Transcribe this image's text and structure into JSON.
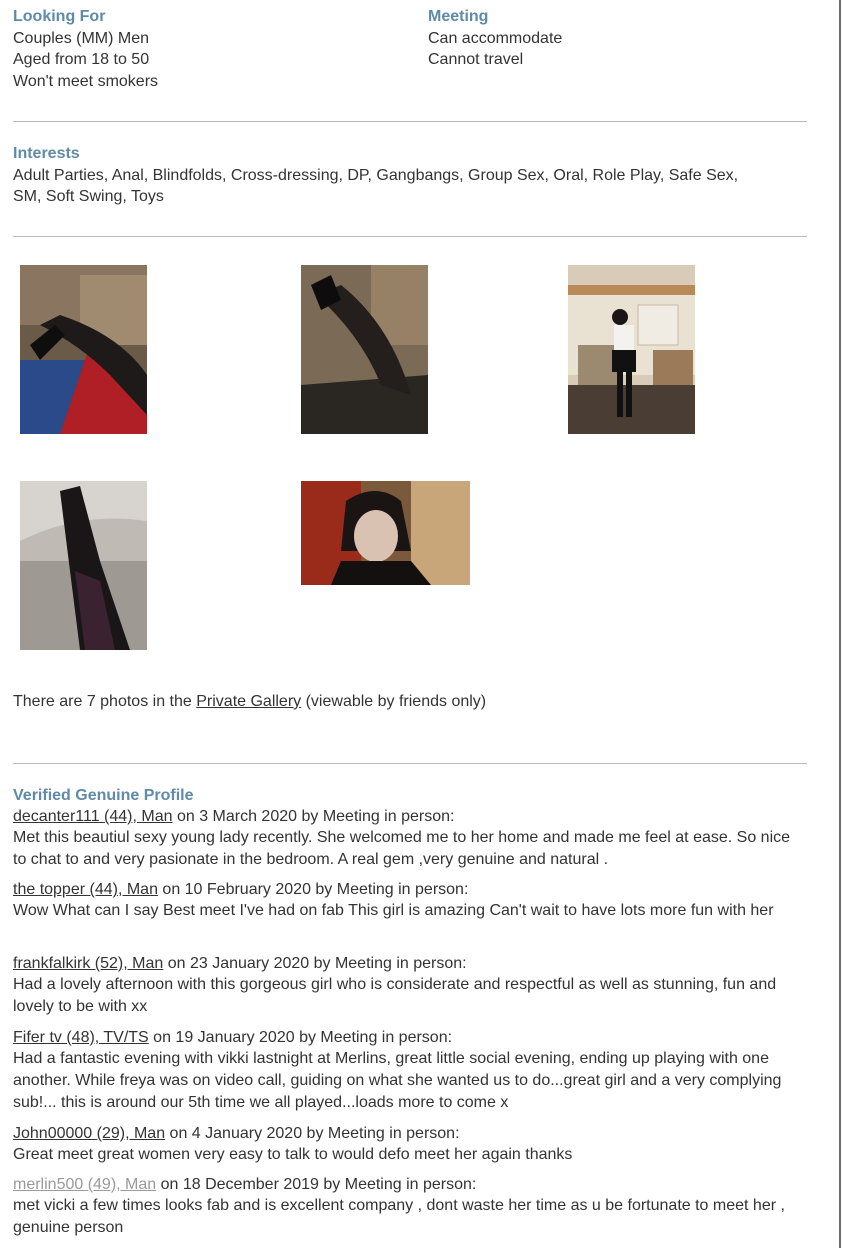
{
  "looking_for": {
    "heading": "Looking For",
    "lines": [
      "Couples (MM) Men",
      "Aged from 18 to 50",
      "Won't meet smokers"
    ]
  },
  "meeting": {
    "heading": "Meeting",
    "lines": [
      "Can accommodate",
      "Cannot travel"
    ]
  },
  "interests": {
    "heading": "Interests",
    "line1": "Adult Parties, Anal, Blindfolds, Cross-dressing, DP, Gangbangs, Group Sex, Oral, Role Play, Safe Sex,",
    "line2": "SM, Soft Swing, Toys"
  },
  "private_gallery": {
    "prefix": "There are 7 photos in the ",
    "link": "Private Gallery",
    "suffix": " (viewable by friends only)"
  },
  "verified": {
    "heading": "Verified Genuine Profile",
    "reviews": [
      {
        "author": "decanter111 (44), Man",
        "meta": " on 3 March 2020 by Meeting in person:",
        "text": "Met this beautiul sexy young lady recently. She welcomed me to her home and made me feel at ease. So nice to chat to and very pasionate in the bedroom. A real gem ,very genuine and natural ."
      },
      {
        "author": "the topper (44), Man",
        "meta": " on 10 February 2020 by Meeting in person:",
        "text": "Wow What can I say Best meet I've had on fab This girl is amazing Can't wait to have lots more fun with her"
      },
      {
        "author": "frankfalkirk (52), Man",
        "meta": " on 23 January 2020 by Meeting in person:",
        "text": "Had a lovely afternoon with this gorgeous girl who is considerate and respectful as well as stunning, fun and lovely to be with xx"
      },
      {
        "author": "Fifer tv (48), TV/TS",
        "meta": " on 19 January 2020 by Meeting in person:",
        "text": "Had a fantastic evening with vikki lastnight at Merlins, great little social evening, ending up playing with one another. While freya was on video call, guiding on what she wanted us to do...great girl and a very complying sub!... this is around our 5th time we all played...loads more to come x"
      },
      {
        "author": "John00000 (29), Man",
        "meta": " on 4 January 2020 by Meeting in person:",
        "text": "Great meet great women very easy to talk to would defo meet her again thanks"
      },
      {
        "author": "merlin500 (49), Man",
        "meta": " on 18 December 2019 by Meeting in person:",
        "text": "met vicki a few times looks fab and is excellent company , dont waste her time as u be fortunate to meet her , genuine person"
      }
    ]
  }
}
